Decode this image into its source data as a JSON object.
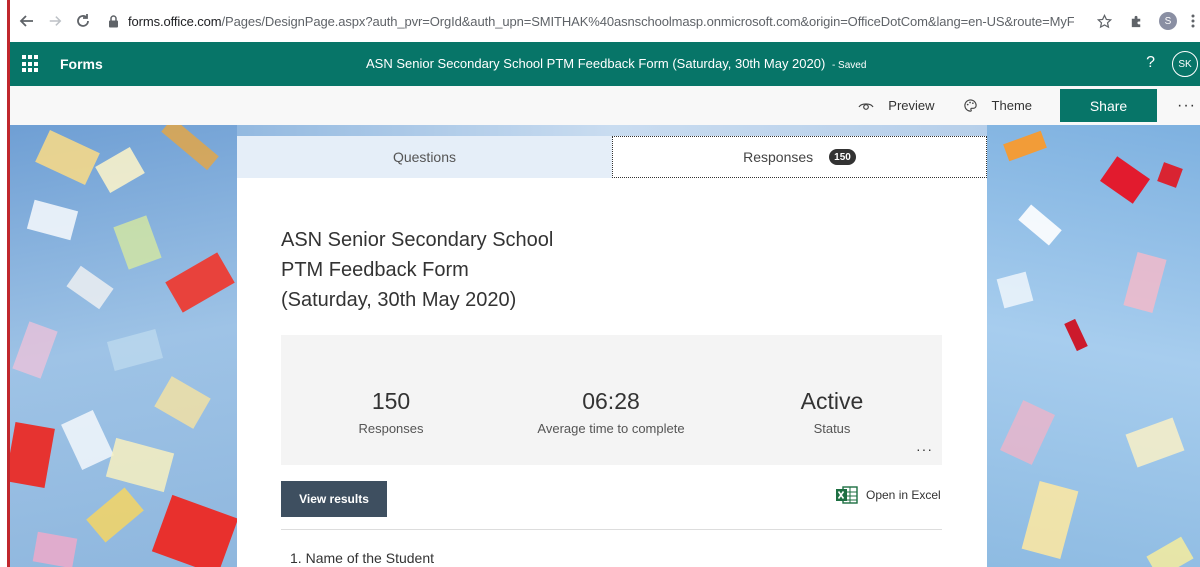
{
  "browser": {
    "url_host": "forms.office.com",
    "url_rest": "/Pages/DesignPage.aspx?auth_pvr=OrgId&auth_upn=SMITHAK%40asnschoolmasp.onmicrosoft.com&origin=OfficeDotCom&lang=en-US&route=MyForms...",
    "profile_initial": "S"
  },
  "appbar": {
    "app_name": "Forms",
    "form_title": "ASN Senior Secondary School PTM Feedback Form (Saturday, 30th May 2020)",
    "saved_label": "- Saved",
    "help": "?",
    "avatar_initials": "SK"
  },
  "commands": {
    "preview": "Preview",
    "theme": "Theme",
    "share": "Share",
    "more": "···"
  },
  "tabs": {
    "questions": "Questions",
    "responses": "Responses",
    "responses_count": "150"
  },
  "form": {
    "title_line1": "ASN Senior Secondary School",
    "title_line2": "PTM Feedback Form",
    "title_line3": "(Saturday, 30th May 2020)"
  },
  "summary": {
    "responses_value": "150",
    "responses_label": "Responses",
    "avg_time_value": "06:28",
    "avg_time_label": "Average time to complete",
    "status_value": "Active",
    "status_label": "Status",
    "more": "···"
  },
  "actions": {
    "view_results": "View results",
    "open_excel": "Open in Excel"
  },
  "questions": [
    {
      "number": "1.",
      "text": "Name of the Student"
    }
  ],
  "colors": {
    "brand": "#077568",
    "view_results_bg": "#3e4f60"
  }
}
